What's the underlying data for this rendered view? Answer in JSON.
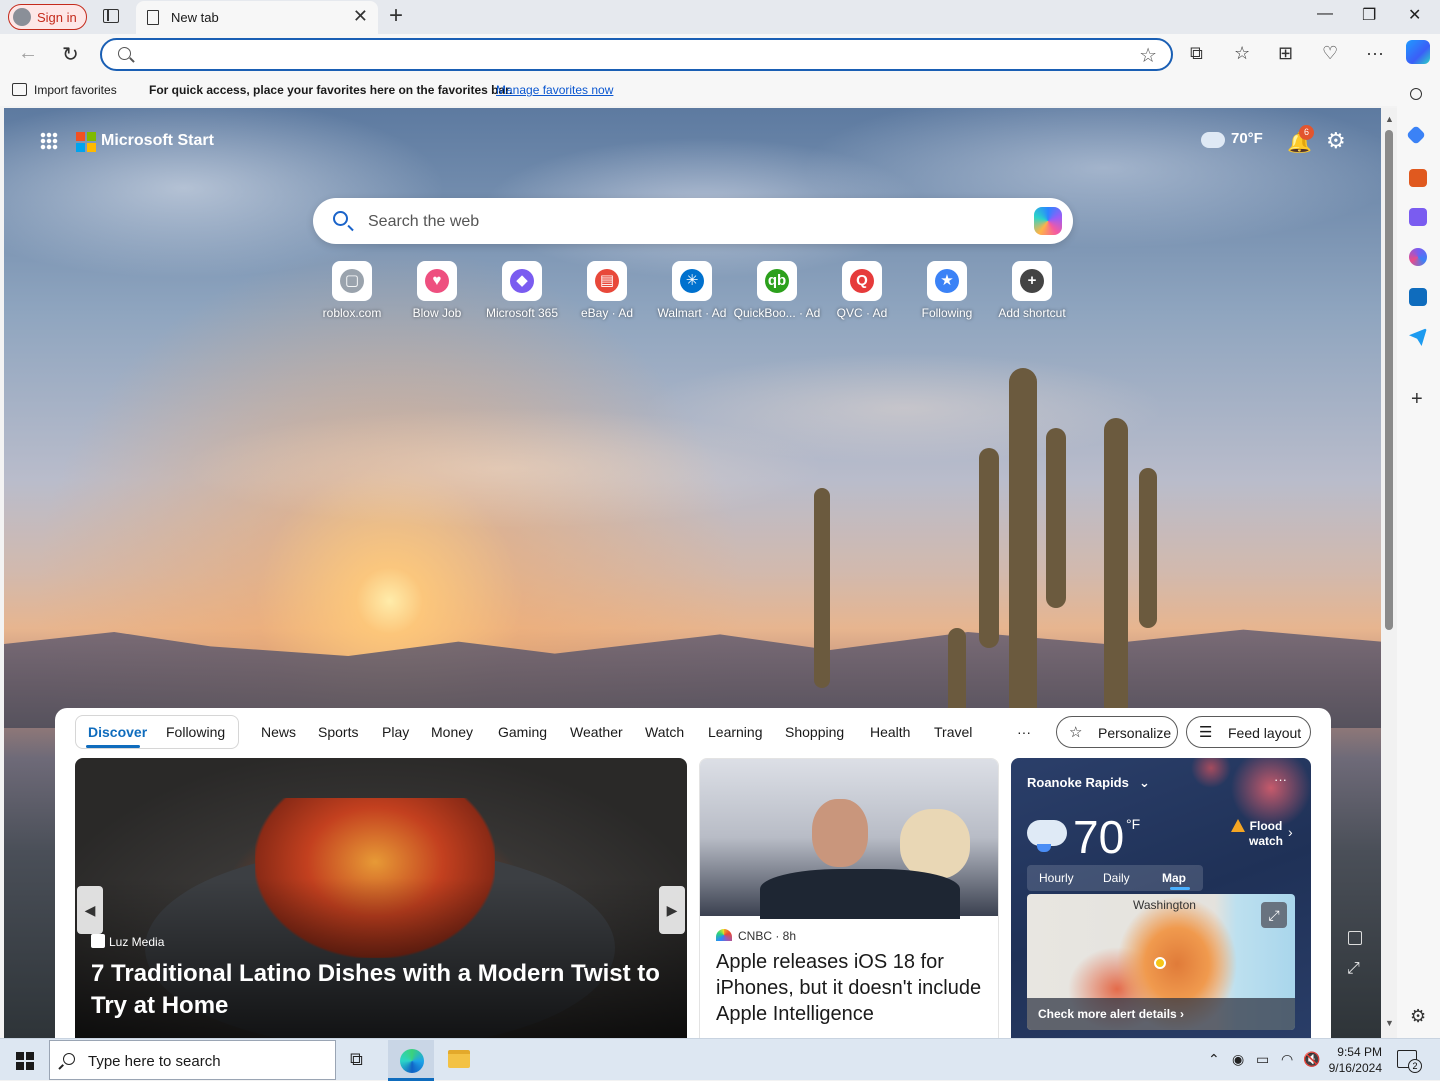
{
  "titlebar": {
    "signin_label": "Sign in",
    "tab_title": "New tab",
    "tab_close": "✕",
    "new_tab": "+",
    "minimize": "—",
    "restore": "❐",
    "close": "✕"
  },
  "toolbar": {
    "back": "←",
    "refresh": "↻",
    "address_value": "",
    "address_placeholder": "",
    "favorite_star": "☆",
    "split": "⧉",
    "favorites": "☆",
    "collections": "⊞",
    "perf": "♡",
    "more": "···"
  },
  "favbar": {
    "import_label": "Import favorites",
    "message": "For quick access, place your favorites here on the favorites bar.",
    "manage_link": "Manage favorites now"
  },
  "header": {
    "brand": "Microsoft Start",
    "weather_temp": "70°F",
    "notifications_count": "6",
    "bell": "🔔",
    "gear": "⚙"
  },
  "search": {
    "placeholder": "Search the web"
  },
  "shortcuts": [
    {
      "label": "roblox.com",
      "glyph": "▢",
      "color": "#9aa3ad"
    },
    {
      "label": "Blow Job",
      "glyph": "♥",
      "color": "#ee4f7f"
    },
    {
      "label": "Microsoft 365",
      "glyph": "◆",
      "color": "#7a5cf0"
    },
    {
      "label": "eBay · Ad",
      "glyph": "▤",
      "color": "#e8483a"
    },
    {
      "label": "Walmart · Ad",
      "glyph": "✳",
      "color": "#0071ce"
    },
    {
      "label": "QuickBoo... · Ad",
      "glyph": "qb",
      "color": "#2ca01c"
    },
    {
      "label": "QVC · Ad",
      "glyph": "Q",
      "color": "#e63b3b"
    },
    {
      "label": "Following",
      "glyph": "★",
      "color": "#3b82f6"
    },
    {
      "label": "Add shortcut",
      "glyph": "+",
      "color": "#444444"
    }
  ],
  "feed": {
    "tabs": [
      "Discover",
      "Following",
      "News",
      "Sports",
      "Play",
      "Money",
      "Gaming",
      "Weather",
      "Watch",
      "Learning",
      "Shopping",
      "Health",
      "Travel"
    ],
    "more": "···",
    "personalize": "Personalize",
    "feed_layout": "Feed layout",
    "hero": {
      "source": "Luz Media",
      "title": "7 Traditional Latino Dishes with a Modern Twist to Try at Home"
    },
    "card2": {
      "source": "CNBC · 8h",
      "title": "Apple releases iOS 18 for iPhones, but it doesn't include Apple Intelligence"
    },
    "weather": {
      "city": "Roanoke Rapids",
      "chevron": "⌄",
      "dots": "···",
      "temp": "70",
      "unit": "°F",
      "alert": "Flood watch",
      "tabs": [
        "Hourly",
        "Daily",
        "Map"
      ],
      "map_label": "Washington",
      "cta": "Check more alert details ›"
    }
  },
  "taskbar": {
    "search_placeholder": "Type here to search",
    "time": "9:54 PM",
    "date": "9/16/2024",
    "notif_count": "2"
  }
}
